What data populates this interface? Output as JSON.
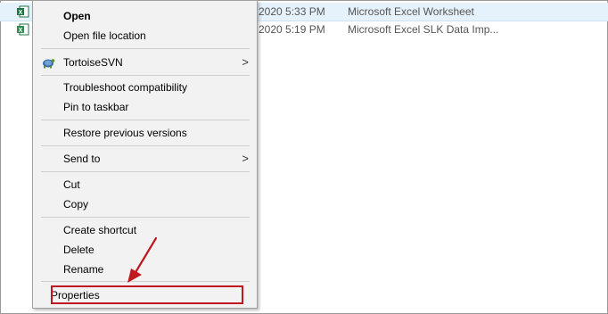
{
  "files": [
    {
      "date": "2020 5:33 PM",
      "type": "Microsoft Excel Worksheet",
      "icon": "excel-file-icon"
    },
    {
      "date": "2020 5:19 PM",
      "type": "Microsoft Excel SLK Data Imp...",
      "icon": "excel-slk-file-icon"
    }
  ],
  "menu": {
    "open": "Open",
    "open_file_location": "Open file location",
    "tortoisesvn": "TortoiseSVN",
    "troubleshoot": "Troubleshoot compatibility",
    "pin_taskbar": "Pin to taskbar",
    "restore_versions": "Restore previous versions",
    "send_to": "Send to",
    "cut": "Cut",
    "copy": "Copy",
    "create_shortcut": "Create shortcut",
    "delete": "Delete",
    "rename": "Rename",
    "properties": "Properties",
    "submenu_arrow": ">"
  },
  "colors": {
    "highlight": "#c0181f",
    "menu_bg": "#f2f2f2",
    "selection": "#e5f1fb"
  }
}
